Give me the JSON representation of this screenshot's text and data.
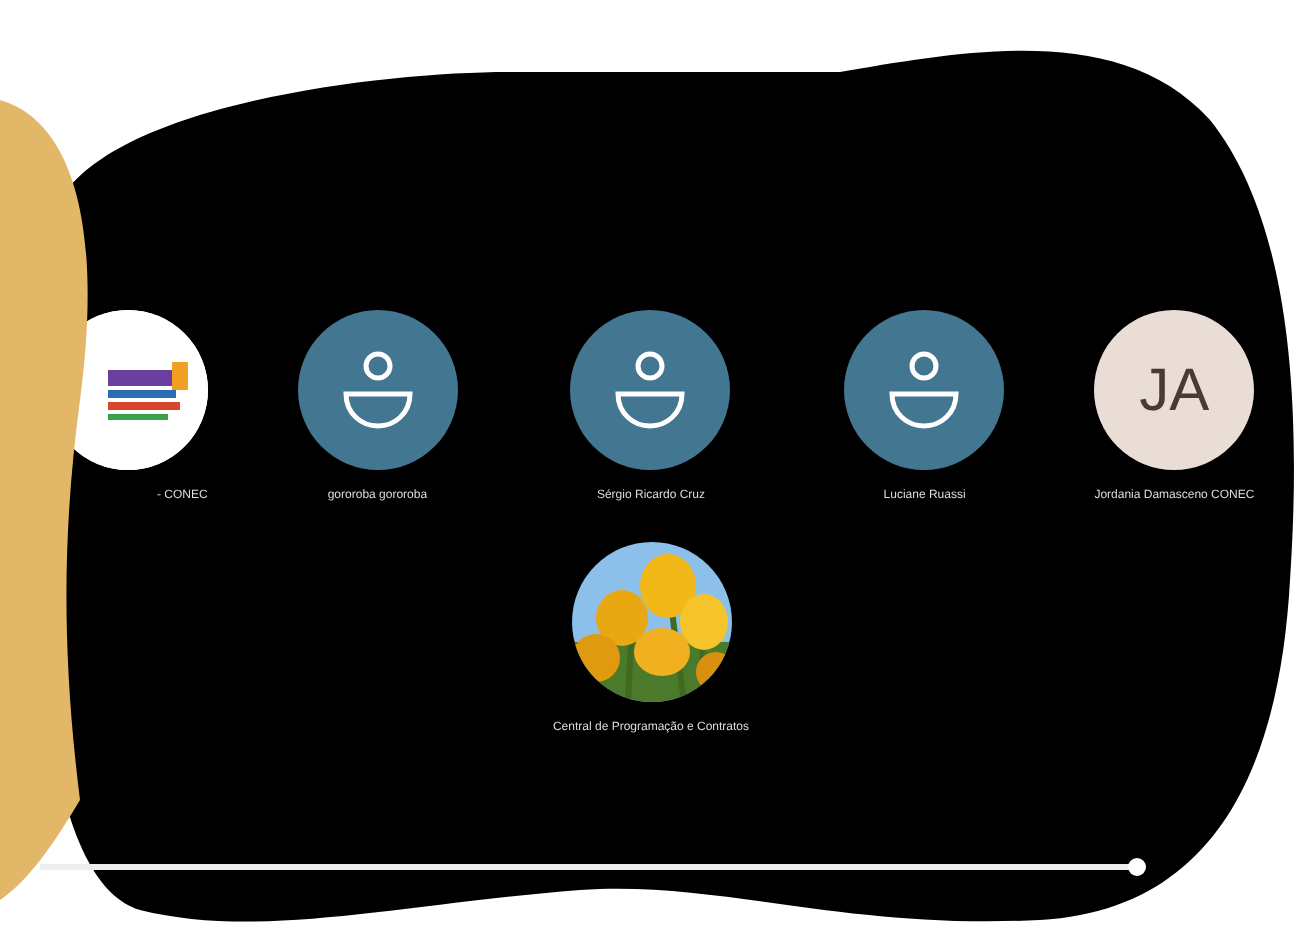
{
  "participants": [
    {
      "name": "- CONEC",
      "kind": "logo"
    },
    {
      "name": "gororoba gororoba",
      "kind": "person"
    },
    {
      "name": "Sérgio Ricardo Cruz",
      "kind": "person"
    },
    {
      "name": "Luciane Ruassi",
      "kind": "person"
    },
    {
      "name": "Jordania Damasceno CONEC",
      "kind": "initials",
      "initials": "JA"
    },
    {
      "name": "Central de Programação e Contratos"
    }
  ],
  "progress": {
    "level": 1
  }
}
